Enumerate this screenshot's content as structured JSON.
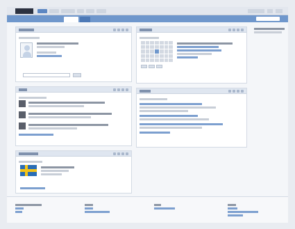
{
  "topbar": {
    "logo_name": "brand-logo",
    "nav_count": 6
  },
  "tabs": {
    "active_index": 0
  },
  "colors": {
    "accent_band": "#6f97cc",
    "panel_header": "#dfe6f0",
    "link_text": "#7c9fcf",
    "calendar_selected": "#6f97cc",
    "flag_blue": "#2a6db5",
    "flag_yellow": "#f5c518"
  },
  "icons": [
    "avatar-placeholder-icon",
    "panel-tool-icon",
    "calendar-icon",
    "flag-icon"
  ]
}
